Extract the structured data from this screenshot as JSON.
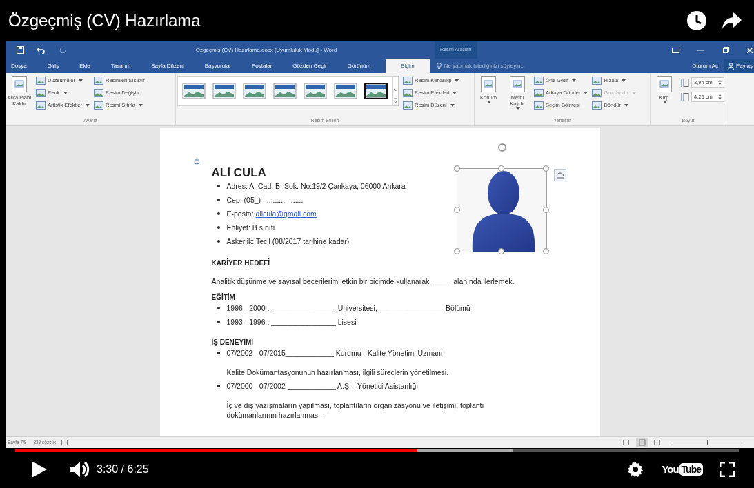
{
  "video_title": "Özgeçmiş (CV) Hazırlama",
  "word": {
    "title": "Özgeçmiş (CV) Hazırlama.docx [Uyumluluk Modu] - Word",
    "context_group": "Resim Araçları",
    "tabs": [
      {
        "label": "Dosya",
        "selected": false
      },
      {
        "label": "Giriş",
        "selected": false
      },
      {
        "label": "Ekle",
        "selected": false
      },
      {
        "label": "Tasarım",
        "selected": false
      },
      {
        "label": "Sayfa Düzeni",
        "selected": false
      },
      {
        "label": "Başvurular",
        "selected": false
      },
      {
        "label": "Postalar",
        "selected": false
      },
      {
        "label": "Gözden Geçir",
        "selected": false
      },
      {
        "label": "Görünüm",
        "selected": false
      },
      {
        "label": "Biçim",
        "selected": true
      }
    ],
    "tell_me": "Ne yapmak istediğinizi söyleyin...",
    "sign_in": "Oturum Aç",
    "share": "Paylaş",
    "groups": [
      {
        "label": "Ayarla",
        "items": [
          {
            "kind": "large",
            "label": "Arka Planı Kaldır",
            "dropdown": false,
            "disabled": false
          },
          {
            "kind": "small",
            "label": "Düzeltmeler",
            "dropdown": true,
            "disabled": false
          },
          {
            "kind": "small",
            "label": "Renk",
            "dropdown": true,
            "disabled": false
          },
          {
            "kind": "small",
            "label": "Artistik Efektler",
            "dropdown": true,
            "disabled": false
          },
          {
            "kind": "small",
            "label": "Resimleri Sıkıştır",
            "dropdown": false,
            "disabled": false
          },
          {
            "kind": "small",
            "label": "Resim Değiştir",
            "dropdown": false,
            "disabled": false
          },
          {
            "kind": "small",
            "label": "Resmi Sıfırla",
            "dropdown": true,
            "disabled": false
          }
        ]
      },
      {
        "label": "Resim Stilleri",
        "items": [
          {
            "kind": "gallery"
          },
          {
            "kind": "small",
            "label": "Resim Kenarlığı",
            "dropdown": true,
            "disabled": false
          },
          {
            "kind": "small",
            "label": "Resim Efektleri",
            "dropdown": true,
            "disabled": false
          },
          {
            "kind": "small",
            "label": "Resim Düzeni",
            "dropdown": true,
            "disabled": false
          }
        ]
      },
      {
        "label": "Yerleştir",
        "items": [
          {
            "kind": "large",
            "label": "Konum",
            "dropdown": true,
            "disabled": false
          },
          {
            "kind": "large",
            "label": "Metni Kaydır",
            "dropdown": true,
            "disabled": false
          },
          {
            "kind": "small",
            "label": "Öne Getir",
            "dropdown": true,
            "disabled": false
          },
          {
            "kind": "small",
            "label": "Arkaya Gönder",
            "dropdown": true,
            "disabled": false
          },
          {
            "kind": "small",
            "label": "Seçim Bölmesi",
            "dropdown": false,
            "disabled": false
          },
          {
            "kind": "small",
            "label": "Hizala",
            "dropdown": true,
            "disabled": false
          },
          {
            "kind": "small",
            "label": "Gruplandır",
            "dropdown": true,
            "disabled": true
          },
          {
            "kind": "small",
            "label": "Döndür",
            "dropdown": true,
            "disabled": false
          }
        ]
      },
      {
        "label": "Boyut",
        "items": [
          {
            "kind": "large",
            "label": "Kırp",
            "dropdown": true,
            "disabled": false
          },
          {
            "kind": "spinner",
            "value": "3,94 cm"
          },
          {
            "kind": "spinner",
            "value": "4,26 cm"
          }
        ]
      }
    ],
    "status": {
      "page": "Sayfa 7/8",
      "words": "839 sözcük",
      "zoom_slider": {
        "level": 0.5
      }
    }
  },
  "document": {
    "name": "ALİ CULA",
    "contact": [
      {
        "text": "Adres: A. Cad. B. Sok. No:19/2 Çankaya, 06000 Ankara"
      },
      {
        "text": "Cep: (05_) ...................."
      },
      {
        "text": "E-posta:",
        "link": "alicula@gmail.com"
      },
      {
        "text": "Ehliyet: B sınıfı"
      },
      {
        "text": "Askerlik: Tecil (08/2017 tarihine kadar)"
      }
    ],
    "sections": [
      {
        "heading": "KARİYER HEDEFİ",
        "paragraph": "Analitik düşünme ve sayısal becerilerimi etkin bir biçimde kullanarak _____ alanında ilerlemek."
      },
      {
        "heading": "EĞİTİM",
        "items": [
          {
            "text": "1996 - 2000 : ________________ Üniversitesi, ________________ Bölümü"
          },
          {
            "text": "1993 - 1996 : ________________ Lisesi"
          }
        ]
      },
      {
        "heading": "İŞ DENEYİMİ",
        "items": [
          {
            "text": "07/2002 - 07/2015____________ Kurumu - Kalite Yönetimi Uzmanı",
            "note": "Kalite Dokümantasyonunun hazırlanması, ilgili süreçlerin yönetilmesi."
          },
          {
            "text": "07/2000 - 07/2002 ____________ A.Ş. - Yönetici Asistanlığı",
            "note": "İç ve dış yazışmaların yapılması, toplantıların organizasyonu ve iletişimi, toplantı dokümanlarının hazırlanması."
          }
        ]
      }
    ]
  },
  "player": {
    "played": {
      "level": 0.556
    },
    "buffered": {
      "level": 0.687
    },
    "time": "3:30 / 6:25",
    "logo_left": "You",
    "logo_right": "Tube"
  }
}
